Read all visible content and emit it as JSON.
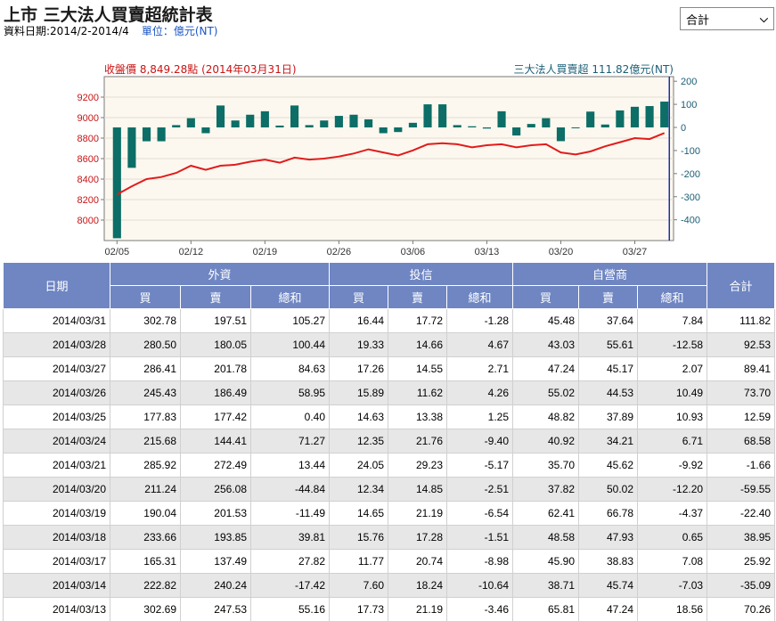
{
  "header": {
    "title": "上市 三大法人買賣超統計表",
    "date_range": "資料日期:2014/2-2014/4",
    "unit": "單位：億元(NT)"
  },
  "selector": {
    "value": "合計"
  },
  "chart_data": {
    "type": "bar+line",
    "left_title": "收盤價 8,849.28點 (2014年03月31日)",
    "right_title": "三大法人買賣超 111.82億元(NT)",
    "left_axis": {
      "min": 7800,
      "max": 9400,
      "ticks": [
        8000,
        8200,
        8400,
        8600,
        8800,
        9000,
        9200
      ]
    },
    "right_axis": {
      "min": -490,
      "max": 220,
      "ticks": [
        -400,
        -300,
        -200,
        -100,
        0,
        100,
        200
      ]
    },
    "x_ticks": [
      "02/05",
      "02/12",
      "02/19",
      "02/26",
      "03/06",
      "03/13",
      "03/20",
      "03/27"
    ],
    "x_tick_index": [
      0,
      5,
      10,
      15,
      20,
      25,
      30,
      35
    ],
    "colors": {
      "bar": "#0c6e66",
      "line": "#e31b1b",
      "left_axis": "#c81414",
      "right_axis": "#1a5e75",
      "cursor": "#1f2ea8"
    },
    "net_buy": [
      -480,
      -175,
      -60,
      -60,
      10,
      40,
      -25,
      95,
      30,
      55,
      70,
      8,
      95,
      10,
      30,
      50,
      55,
      35,
      -25,
      -20,
      20,
      100,
      100,
      10,
      5,
      -5,
      70,
      -35,
      15,
      40,
      -59.55,
      -1.66,
      68.58,
      12.59,
      73.7,
      89.41,
      92.53,
      111.82
    ],
    "close": [
      8250,
      8330,
      8400,
      8420,
      8460,
      8530,
      8490,
      8530,
      8540,
      8570,
      8590,
      8560,
      8610,
      8590,
      8600,
      8620,
      8650,
      8690,
      8660,
      8630,
      8680,
      8740,
      8750,
      8740,
      8710,
      8730,
      8740,
      8710,
      8730,
      8740,
      8660,
      8640,
      8670,
      8720,
      8760,
      8800,
      8790,
      8849.28
    ]
  },
  "table": {
    "headers": {
      "date": "日期",
      "foreign": "外資",
      "trust": "投信",
      "dealer": "自營商",
      "total": "合計",
      "buy": "買",
      "sell": "賣",
      "sum": "總和"
    },
    "rows": [
      [
        "2014/03/31",
        "302.78",
        "197.51",
        "105.27",
        "16.44",
        "17.72",
        "-1.28",
        "45.48",
        "37.64",
        "7.84",
        "111.82"
      ],
      [
        "2014/03/28",
        "280.50",
        "180.05",
        "100.44",
        "19.33",
        "14.66",
        "4.67",
        "43.03",
        "55.61",
        "-12.58",
        "92.53"
      ],
      [
        "2014/03/27",
        "286.41",
        "201.78",
        "84.63",
        "17.26",
        "14.55",
        "2.71",
        "47.24",
        "45.17",
        "2.07",
        "89.41"
      ],
      [
        "2014/03/26",
        "245.43",
        "186.49",
        "58.95",
        "15.89",
        "11.62",
        "4.26",
        "55.02",
        "44.53",
        "10.49",
        "73.70"
      ],
      [
        "2014/03/25",
        "177.83",
        "177.42",
        "0.40",
        "14.63",
        "13.38",
        "1.25",
        "48.82",
        "37.89",
        "10.93",
        "12.59"
      ],
      [
        "2014/03/24",
        "215.68",
        "144.41",
        "71.27",
        "12.35",
        "21.76",
        "-9.40",
        "40.92",
        "34.21",
        "6.71",
        "68.58"
      ],
      [
        "2014/03/21",
        "285.92",
        "272.49",
        "13.44",
        "24.05",
        "29.23",
        "-5.17",
        "35.70",
        "45.62",
        "-9.92",
        "-1.66"
      ],
      [
        "2014/03/20",
        "211.24",
        "256.08",
        "-44.84",
        "12.34",
        "14.85",
        "-2.51",
        "37.82",
        "50.02",
        "-12.20",
        "-59.55"
      ],
      [
        "2014/03/19",
        "190.04",
        "201.53",
        "-11.49",
        "14.65",
        "21.19",
        "-6.54",
        "62.41",
        "66.78",
        "-4.37",
        "-22.40"
      ],
      [
        "2014/03/18",
        "233.66",
        "193.85",
        "39.81",
        "15.76",
        "17.28",
        "-1.51",
        "48.58",
        "47.93",
        "0.65",
        "38.95"
      ],
      [
        "2014/03/17",
        "165.31",
        "137.49",
        "27.82",
        "11.77",
        "20.74",
        "-8.98",
        "45.90",
        "38.83",
        "7.08",
        "25.92"
      ],
      [
        "2014/03/14",
        "222.82",
        "240.24",
        "-17.42",
        "7.60",
        "18.24",
        "-10.64",
        "38.71",
        "45.74",
        "-7.03",
        "-35.09"
      ],
      [
        "2014/03/13",
        "302.69",
        "247.53",
        "55.16",
        "17.73",
        "21.19",
        "-3.46",
        "65.81",
        "47.24",
        "18.56",
        "70.26"
      ]
    ]
  }
}
